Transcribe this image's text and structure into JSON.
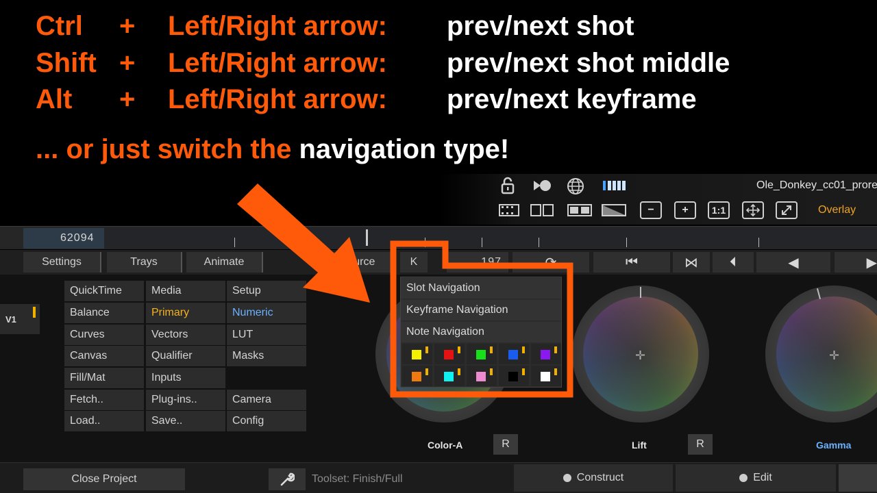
{
  "headline": {
    "rows": [
      {
        "modifier": "Ctrl",
        "plus": "+",
        "keys": "Left/Right arrow:",
        "action": "prev/next shot"
      },
      {
        "modifier": "Shift",
        "plus": "+",
        "keys": "Left/Right arrow:",
        "action": "prev/next shot middle"
      },
      {
        "modifier": "Alt",
        "plus": "+",
        "keys": "Left/Right arrow:",
        "action": "prev/next keyframe"
      }
    ],
    "tagline_prefix": "... or just switch the ",
    "tagline_suffix": "navigation type!"
  },
  "viewer": {
    "clip_name": "Ole_Donkey_cc01_prore",
    "icons": [
      "lock-icon",
      "record-icon",
      "globe-icon",
      "level-bars-icon"
    ],
    "buttons": [
      "filmstrip-icon",
      "split-icon",
      "compare-icon",
      "wipe-icon",
      "zoom-out-icon",
      "zoom-in-icon",
      "one-to-one-icon",
      "fit-icon",
      "fullscreen-icon"
    ],
    "zoom_out": "−",
    "zoom_in": "+",
    "one_to_one": "1:1",
    "overlay_label": "Overlay"
  },
  "timeline": {
    "frame_number": "62094"
  },
  "toolrow": {
    "settings": "Settings",
    "trays": "Trays",
    "animate": "Animate",
    "source": "Source",
    "k_button": "K",
    "frame": "197",
    "loop_icon": "⟳",
    "first_icon": "⏮",
    "bowtie_icon": "⋈",
    "prev_edit_icon": "⏴",
    "play_back_icon": "◀",
    "play_fwd_icon": "▶"
  },
  "track": {
    "label": "V1"
  },
  "menu": {
    "col1": [
      "QuickTime",
      "Balance",
      "Curves",
      "Canvas",
      "Fill/Mat",
      "Fetch..",
      "Load.."
    ],
    "col2": [
      "Media",
      "Primary",
      "Vectors",
      "Qualifier",
      "Inputs",
      "Plug-ins..",
      "Save.."
    ],
    "col3": [
      "Setup",
      "Numeric",
      "LUT",
      "Masks",
      "",
      "Camera",
      "Config"
    ]
  },
  "dropdown": {
    "items": [
      "Slot Navigation",
      "Keyframe Navigation",
      "Note Navigation"
    ],
    "swatches": [
      "#f5f000",
      "#e51212",
      "#18e018",
      "#1a5cf0",
      "#8a18f0",
      "#f07a10",
      "#10f0f0",
      "#f08ad0",
      "#000000",
      "#ffffff"
    ]
  },
  "wheels": {
    "color_a": "Color-A",
    "lift": "Lift",
    "gamma": "Gamma",
    "reset": "R"
  },
  "bottombar": {
    "close_project": "Close Project",
    "toolset": "Toolset: Finish/Full",
    "construct": "Construct",
    "edit": "Edit"
  },
  "colors": {
    "accent_orange": "#ff5a0a",
    "primary_yellow": "#f5b21f",
    "numeric_blue": "#6ab1ff",
    "gamma_blue": "#6ab1ff",
    "overlay_amber": "#f0a422"
  }
}
